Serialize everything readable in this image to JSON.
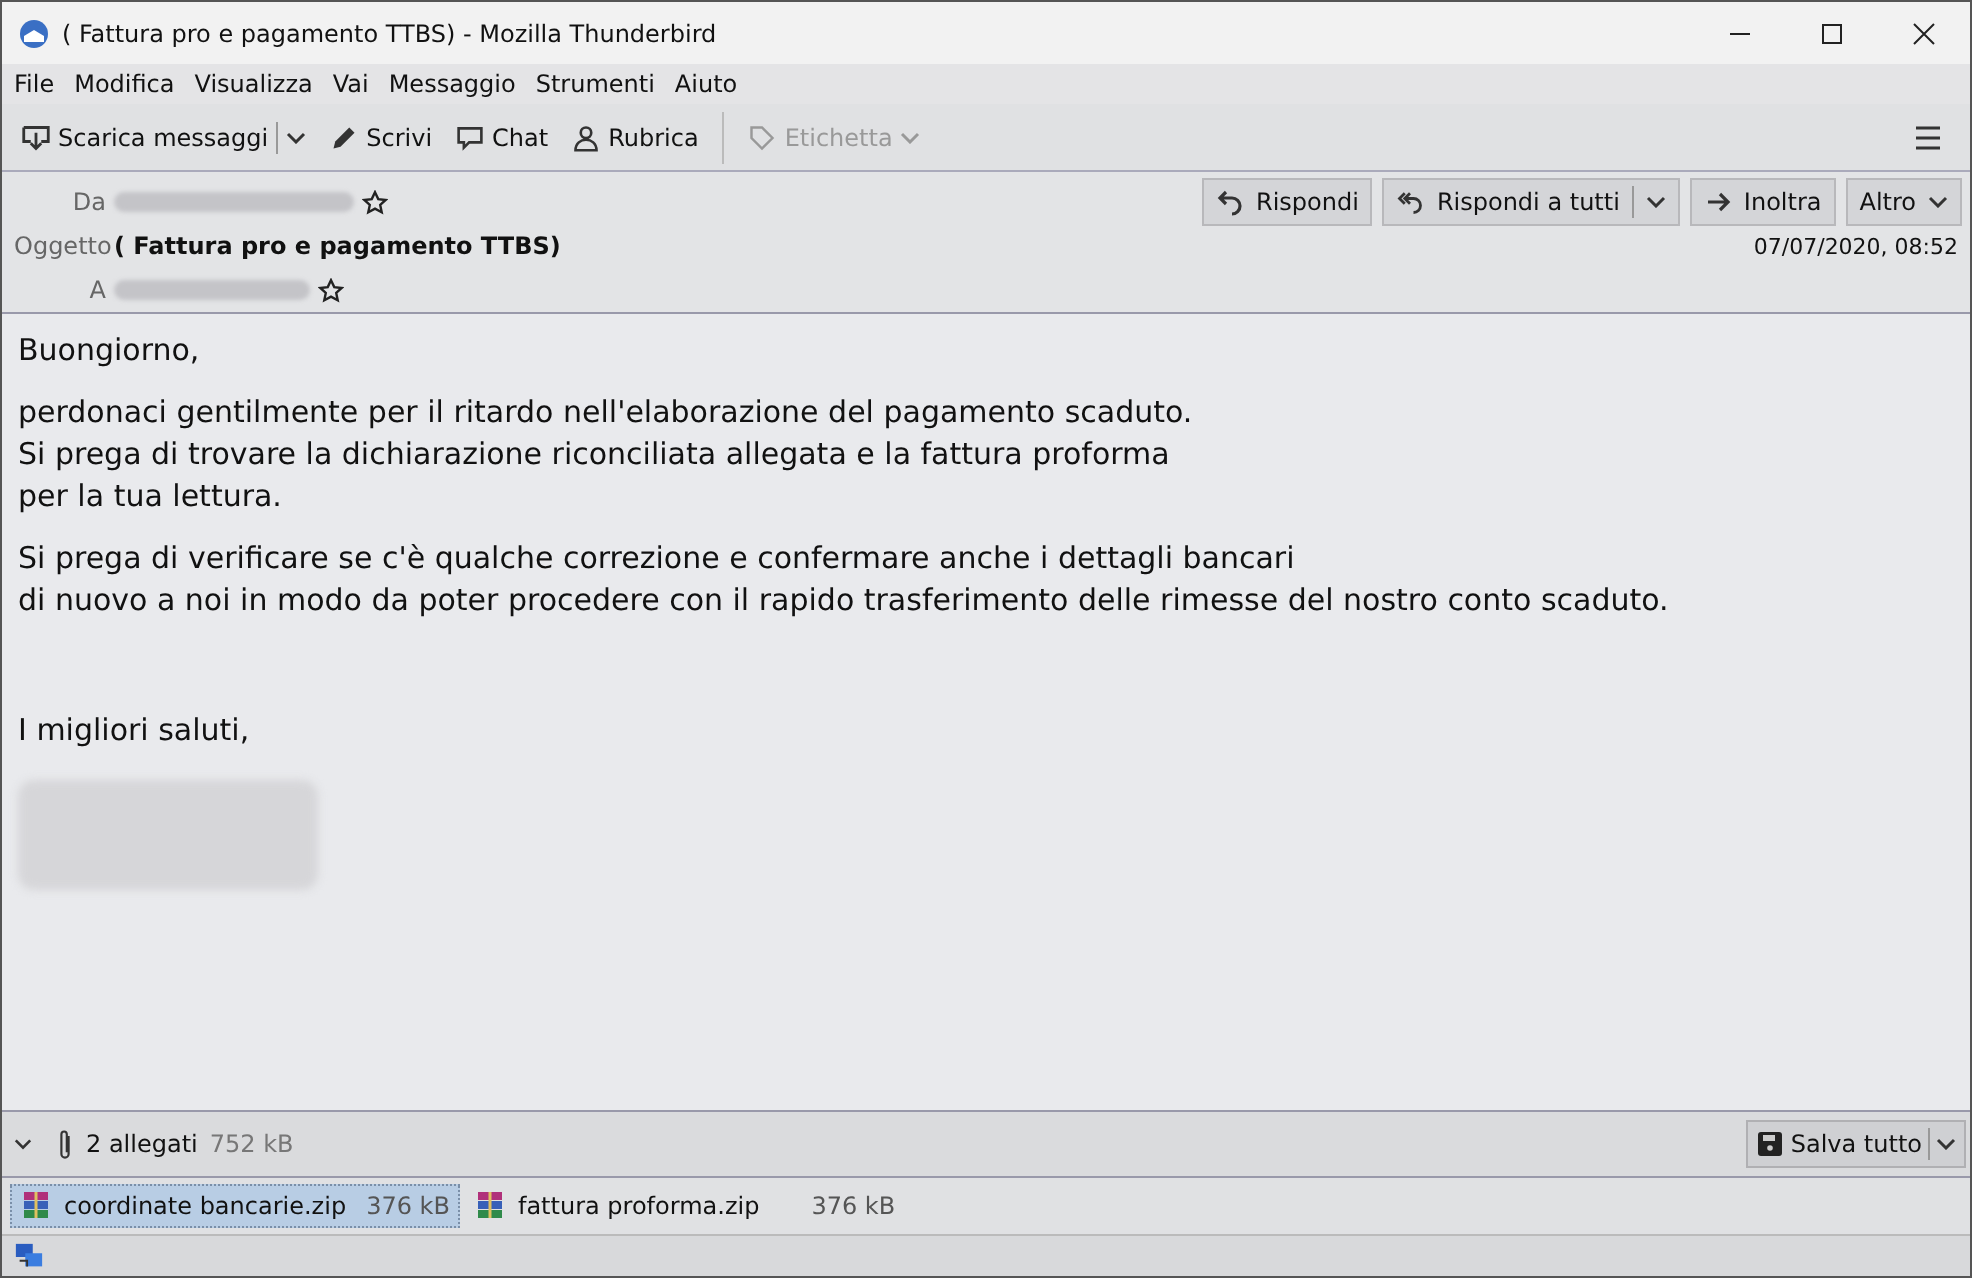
{
  "window": {
    "title": "( Fattura pro e pagamento TTBS) - Mozilla Thunderbird"
  },
  "menu": [
    "File",
    "Modifica",
    "Visualizza",
    "Vai",
    "Messaggio",
    "Strumenti",
    "Aiuto"
  ],
  "toolbar": [
    {
      "kind": "download",
      "label": "Scarica messaggi",
      "disabled": false,
      "dropdown": true
    },
    {
      "kind": "compose",
      "label": "Scrivi",
      "disabled": false,
      "dropdown": false
    },
    {
      "kind": "chat",
      "label": "Chat",
      "disabled": false,
      "dropdown": false
    },
    {
      "kind": "contacts",
      "label": "Rubrica",
      "disabled": false,
      "dropdown": false
    },
    {
      "kind": "tag",
      "label": "Etichetta",
      "disabled": true,
      "dropdown": true
    }
  ],
  "header": {
    "from_label": "Da",
    "subject_label": "Oggetto",
    "subject": "( Fattura pro e pagamento TTBS)",
    "to_label": "A",
    "date": "07/07/2020, 08:52",
    "actions": [
      {
        "kind": "reply",
        "label": "Rispondi",
        "dropdown": false
      },
      {
        "kind": "replyall",
        "label": "Rispondi a tutti",
        "dropdown": true
      },
      {
        "kind": "forward",
        "label": "Inoltra",
        "dropdown": false
      },
      {
        "kind": "more",
        "label": "Altro",
        "dropdown": true
      }
    ]
  },
  "body": [
    "Buongiorno,",
    "perdonaci gentilmente per il ritardo nell'elaborazione del pagamento scaduto.\nSi prega di trovare la dichiarazione riconciliata allegata e la fattura proforma\nper la tua lettura.",
    "Si prega di verificare se c'è qualche correzione e confermare anche i dettagli bancari\ndi nuovo a noi in modo da poter procedere con il rapido trasferimento delle rimesse del nostro conto scaduto.",
    "I migliori saluti,"
  ],
  "attachments": {
    "count": "2 allegati",
    "size": "752 kB",
    "save": "Salva tutto",
    "items": [
      {
        "name": "coordinate bancarie.zip",
        "size": "376 kB",
        "selected": true
      },
      {
        "name": "fattura proforma.zip",
        "size": "376 kB",
        "selected": false
      }
    ]
  }
}
